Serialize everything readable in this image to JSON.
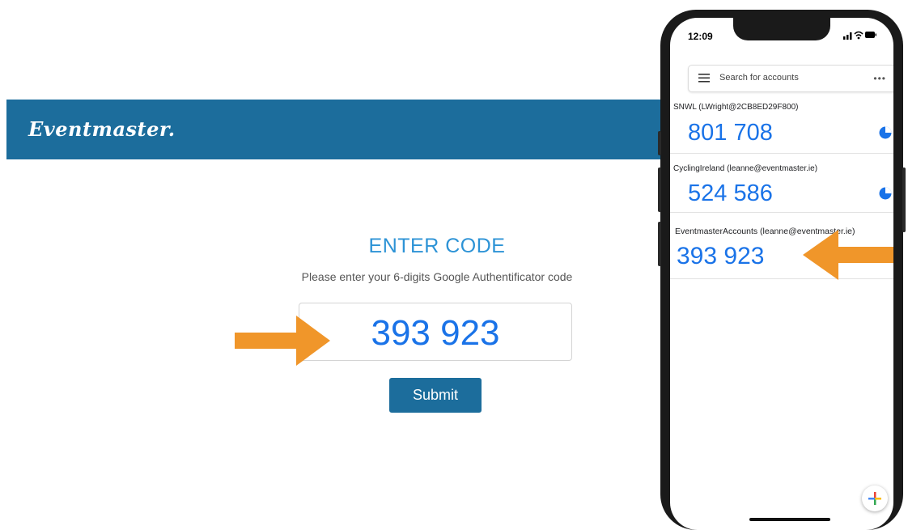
{
  "site": {
    "logo": "Eventmaster.",
    "header_color": "#1c6d9c"
  },
  "form": {
    "title": "ENTER CODE",
    "instructions": "Please enter your 6-digits Google Authentificator code",
    "code_value": "393 923",
    "submit_label": "Submit"
  },
  "phone": {
    "status_time": "12:09",
    "search_placeholder": "Search for accounts",
    "more_label": "•••",
    "accounts": [
      {
        "name": "SNWL (LWright@2CB8ED29F800)",
        "code": "801 708"
      },
      {
        "name": "CyclingIreland (leanne@eventmaster.ie)",
        "code": "524 586"
      },
      {
        "name": "EventmasterAccounts (leanne@eventmaster.ie)",
        "code": "393 923"
      }
    ],
    "fab_label": "+"
  },
  "colors": {
    "accent_blue": "#1a73e8",
    "arrow_orange": "#f0962a"
  },
  "icons": [
    "menu-icon",
    "more-icon",
    "timer-icon",
    "add-icon",
    "signal-icon",
    "wifi-icon",
    "battery-icon"
  ]
}
